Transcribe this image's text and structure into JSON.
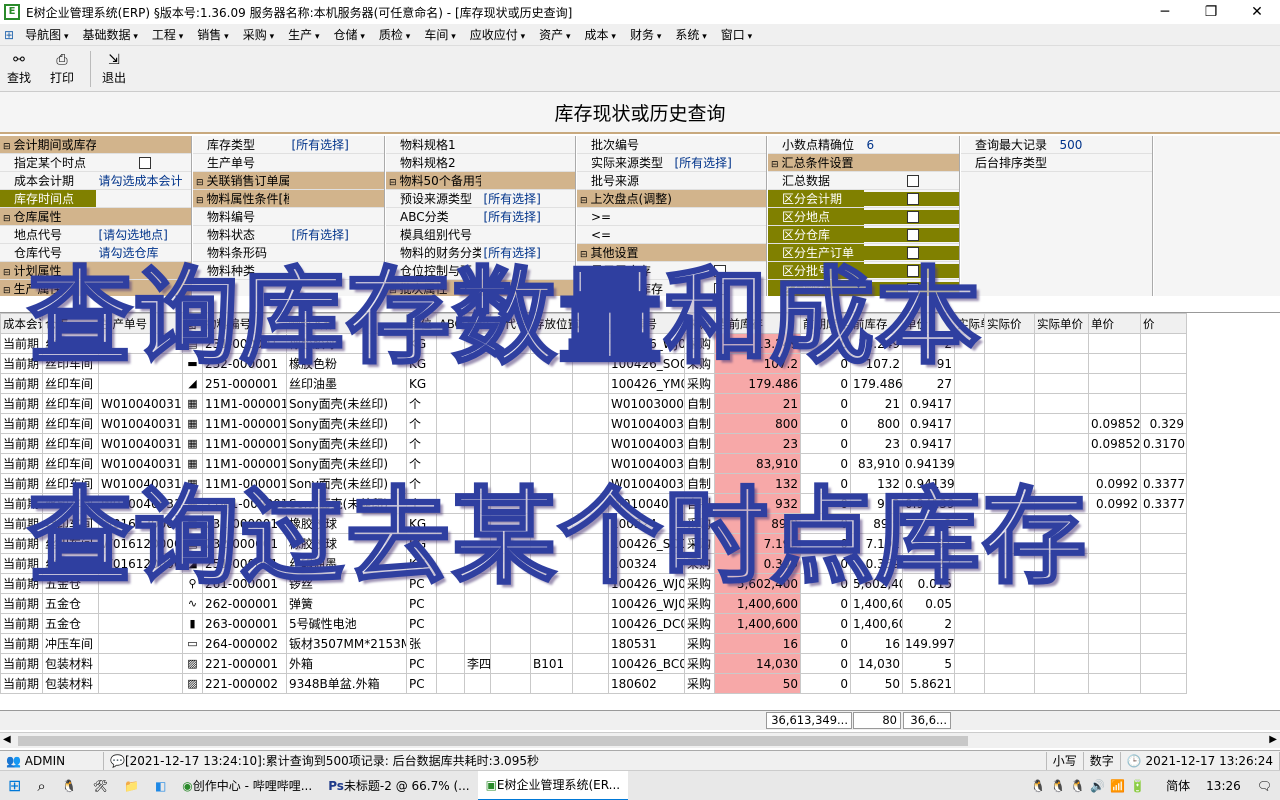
{
  "window": {
    "title": "E树企业管理系统(ERP) §版本号:1.36.09  服务器名称:本机服务器(可任意命名) - [库存现状或历史查询]",
    "min": "─",
    "max": "❐",
    "close": "✕"
  },
  "menu": [
    "导航图",
    "基础数据",
    "工程",
    "销售",
    "采购",
    "生产",
    "仓储",
    "质检",
    "车间",
    "应收应付",
    "资产",
    "成本",
    "财务",
    "系统",
    "窗口"
  ],
  "toolbar": {
    "find": "查找",
    "print": "打印",
    "exit": "退出"
  },
  "page_title": "库存现状或历史查询",
  "filters": {
    "p1": [
      {
        "k": "会计期间或库存时间点",
        "grp": true
      },
      {
        "k": "指定某个时点",
        "chk": true
      },
      {
        "k": "成本会计期",
        "v": "请勾选成本会计"
      },
      {
        "k": "库存时间点",
        "v": "",
        "olive": true
      },
      {
        "k": "仓库属性",
        "grp": true
      },
      {
        "k": "地点代号",
        "v": "[请勾选地点]"
      },
      {
        "k": "仓库代号",
        "v": "请勾选仓库"
      },
      {
        "k": "计划属性",
        "grp": true
      },
      {
        "k": "生产属性",
        "grp": true
      }
    ],
    "p2": [
      {
        "k": "库存类型",
        "v": "[所有选择]"
      },
      {
        "k": "生产单号",
        "v": ""
      },
      {
        "k": "关联销售订单属性",
        "grp": true
      },
      {
        "k": "物料属性条件[模糊]",
        "grp": true
      },
      {
        "k": "物料编号",
        "v": ""
      },
      {
        "k": "物料状态",
        "v": "[所有选择]"
      },
      {
        "k": "物料条形码",
        "v": ""
      },
      {
        "k": "物料种类",
        "v": ""
      }
    ],
    "p3": [
      {
        "k": "物料规格1",
        "v": ""
      },
      {
        "k": "物料规格2",
        "v": ""
      },
      {
        "k": "物料50个备用字段",
        "grp": true
      },
      {
        "k": "预设来源类型",
        "v": "[所有选择]"
      },
      {
        "k": "ABC分类",
        "v": "[所有选择]"
      },
      {
        "k": "模具组别代号",
        "v": ""
      },
      {
        "k": "物料的财务分类",
        "v": "[所有选择]"
      },
      {
        "k": "仓位控制与否",
        "v": ""
      },
      {
        "k": "批次属性",
        "grp": true
      }
    ],
    "p4": [
      {
        "k": "批次编号",
        "v": ""
      },
      {
        "k": "实际来源类型",
        "v": "[所有选择]"
      },
      {
        "k": "批号来源",
        "v": ""
      },
      {
        "k": "上次盘点(调整)时间",
        "grp": true
      },
      {
        "k": ">=",
        "v": ""
      },
      {
        "k": "<=",
        "v": ""
      },
      {
        "k": "其他设置",
        "grp": true
      },
      {
        "k": "显示零库存",
        "chk": true
      },
      {
        "k": "只显示有库存",
        "chk": true
      }
    ],
    "p5": [
      {
        "k": "小数点精确位",
        "v": "6"
      },
      {
        "k": "汇总条件设置",
        "grp": true
      },
      {
        "k": "汇总数据",
        "chk": true
      },
      {
        "k": "区分会计期",
        "chk": true,
        "olive": true
      },
      {
        "k": "区分地点",
        "chk": true,
        "olive": true
      },
      {
        "k": "区分仓库",
        "chk": true,
        "olive": true
      },
      {
        "k": "区分生产订单",
        "chk": true,
        "olive": true
      },
      {
        "k": "区分批号",
        "chk": true,
        "olive": true
      },
      {
        "k": "区分物料",
        "chk": true,
        "olive": true
      }
    ],
    "p6": [
      {
        "k": "查询最大记录",
        "v": "500"
      },
      {
        "k": "后台排序类型",
        "v": ""
      }
    ]
  },
  "grid": {
    "groups": [
      "成本",
      "仓库",
      "生产单号",
      "",
      "物料基本信息",
      "",
      "",
      "",
      "仓位管控",
      "",
      "",
      "批号属性",
      "",
      "批次库存信息",
      "",
      "库存",
      "单价",
      "",
      "",
      "",
      "成本单价",
      "细"
    ],
    "headers": [
      "成本会计期",
      "仓库",
      "生产单号",
      "图",
      "物料编号",
      "物料名称",
      "单位",
      "ABC分类",
      "仓位",
      "员代号",
      "存放位置",
      "说明",
      "批次编号",
      "来源",
      "当前库存",
      "前期库存",
      "前库存",
      "单价",
      "实际单位",
      "实际价",
      "实际单价",
      "单价",
      "价"
    ],
    "rows": [
      [
        "当前期",
        "丝印车间",
        "",
        "▤",
        "231-000001",
        "橡胶胶球",
        "KG",
        "",
        "",
        "",
        "",
        "",
        "100426_WJ0006",
        "采购",
        "13.249",
        "0",
        "13.249",
        "2",
        "",
        "",
        "",
        "",
        ""
      ],
      [
        "当前期",
        "丝印车间",
        "",
        "▬",
        "232-000001",
        "橡胶色粉",
        "KG",
        "",
        "",
        "",
        "",
        "",
        "100426_SO001",
        "采购",
        "107.2",
        "0",
        "107.2",
        "91",
        "",
        "",
        "",
        "",
        ""
      ],
      [
        "当前期",
        "丝印车间",
        "",
        "◢",
        "251-000001",
        "丝印油墨",
        "KG",
        "",
        "",
        "",
        "",
        "",
        "100426_YM0006",
        "采购",
        "179.486",
        "0",
        "179.486",
        "27",
        "",
        "",
        "",
        "",
        ""
      ],
      [
        "当前期",
        "丝印车间",
        "W0100400314",
        "▦",
        "11M1-000001",
        "Sony面壳(未丝印)",
        "个",
        "",
        "",
        "",
        "",
        "",
        "W0100300003",
        "自制",
        "21",
        "0",
        "21",
        "0.9417",
        "",
        "",
        "",
        "",
        ""
      ],
      [
        "当前期",
        "丝印车间",
        "W0100400314",
        "▦",
        "11M1-000001",
        "Sony面壳(未丝印)",
        "个",
        "",
        "",
        "",
        "",
        "",
        "W0100400328",
        "自制",
        "800",
        "0",
        "800",
        "0.9417",
        "",
        "",
        "",
        "0.098527",
        "0.329"
      ],
      [
        "当前期",
        "丝印车间",
        "W0100400314",
        "▦",
        "11M1-000001",
        "Sony面壳(未丝印)",
        "个",
        "",
        "",
        "",
        "",
        "",
        "W0100400329",
        "自制",
        "23",
        "0",
        "23",
        "0.9417",
        "",
        "",
        "",
        "0.098527",
        "0.3170"
      ],
      [
        "当前期",
        "丝印车间",
        "W0100400314",
        "▦",
        "11M1-000001",
        "Sony面壳(未丝印)",
        "个",
        "",
        "",
        "",
        "",
        "",
        "W0100400330",
        "自制",
        "83,910",
        "0",
        "83,910",
        "0.941394",
        "",
        "",
        "",
        "",
        ""
      ],
      [
        "当前期",
        "丝印车间",
        "W0100400314",
        "▦",
        "11M1-000001",
        "Sony面壳(未丝印)",
        "个",
        "",
        "",
        "",
        "",
        "",
        "W0100400331",
        "自制",
        "132",
        "0",
        "132",
        "0.941394",
        "",
        "",
        "",
        "0.0992",
        "0.3377"
      ],
      [
        "当前期",
        "丝印车间",
        "W0100400315",
        "▦",
        "11M1-000001",
        "Sony面壳(未丝印)",
        "个",
        "",
        "",
        "",
        "",
        "",
        "W0100400331",
        "自制",
        "932",
        "0",
        "932",
        "0.941394",
        "",
        "",
        "",
        "0.0992",
        "0.3377"
      ],
      [
        "当前期",
        "丝印车间",
        "W0161200001",
        "▤",
        "231-000001",
        "橡胶胶球",
        "KG",
        "",
        "",
        "",
        "",
        "",
        "100324",
        "采购",
        "89.9",
        "0",
        "89.9",
        "2",
        "",
        "",
        "",
        "",
        ""
      ],
      [
        "当前期",
        "丝印车间",
        "W0161200001",
        "▤",
        "232-000001",
        "橡胶胶球",
        "KG",
        "",
        "",
        "",
        "",
        "",
        "100426_SO001",
        "采购",
        "7.192",
        "0",
        "7.192",
        "91",
        "",
        "",
        "",
        "",
        ""
      ],
      [
        "当前期",
        "丝印车间",
        "W0161200001",
        "◢",
        "251-000001",
        "丝印油墨",
        "KG",
        "",
        "",
        "",
        "",
        "",
        "100324",
        "采购",
        "0.359",
        "0",
        "0.359",
        "27",
        "",
        "",
        "",
        "",
        ""
      ],
      [
        "当前期",
        "五金仓",
        "",
        "⚲",
        "261-000001",
        "锣丝",
        "PC",
        "",
        "",
        "",
        "",
        "",
        "100426_WJ0001",
        "采购",
        "5,602,400",
        "0",
        "5,602,400",
        "0.015",
        "",
        "",
        "",
        "",
        ""
      ],
      [
        "当前期",
        "五金仓",
        "",
        "∿",
        "262-000001",
        "弹簧",
        "PC",
        "",
        "",
        "",
        "",
        "",
        "100426_WJ0001",
        "采购",
        "1,400,600",
        "0",
        "1,400,600",
        "0.05",
        "",
        "",
        "",
        "",
        ""
      ],
      [
        "当前期",
        "五金仓",
        "",
        "▮",
        "263-000001",
        "5号碱性电池",
        "PC",
        "",
        "",
        "",
        "",
        "",
        "100426_DC0001",
        "采购",
        "1,400,600",
        "0",
        "1,400,600",
        "2",
        "",
        "",
        "",
        "",
        ""
      ],
      [
        "当前期",
        "冲压车间",
        "",
        "▭",
        "264-000002",
        "钣材3507MM*2153MM",
        "张",
        "",
        "",
        "",
        "",
        "",
        "180531",
        "采购",
        "16",
        "0",
        "16",
        "149.997",
        "",
        "",
        "",
        "",
        ""
      ],
      [
        "当前期",
        "包装材料",
        "",
        "▨",
        "221-000001",
        "外箱",
        "PC",
        "",
        "李四",
        "",
        "B101",
        "",
        "100426_BC0001",
        "采购",
        "14,030",
        "0",
        "14,030",
        "5",
        "",
        "",
        "",
        "",
        ""
      ],
      [
        "当前期",
        "包装材料",
        "",
        "▨",
        "221-000002",
        "9348B单盆.外箱",
        "PC",
        "",
        "",
        "",
        "",
        "",
        "180602",
        "采购",
        "50",
        "0",
        "50",
        "5.8621",
        "",
        "",
        "",
        "",
        ""
      ]
    ],
    "totals": {
      "stock": "36,613,349...",
      "prev": "80",
      "total": "36,6..."
    }
  },
  "status": {
    "user": "ADMIN",
    "msg": "[2021-12-17 13:24:10]:累计查询到500项记录: 后台数据库共耗时:3.095秒",
    "caps": "小写",
    "num": "数字",
    "time": "2021-12-17 13:26:24"
  },
  "taskbar": {
    "items": [
      "创作中心 - 哔哩哔哩...",
      "未标题-2 @ 66.7% (...",
      "E树企业管理系统(ER..."
    ],
    "lang": "简体",
    "clock": "13:26"
  },
  "overlay": {
    "line1": "查询库存数量和成本",
    "line2": "查询过去某个时点库存"
  }
}
